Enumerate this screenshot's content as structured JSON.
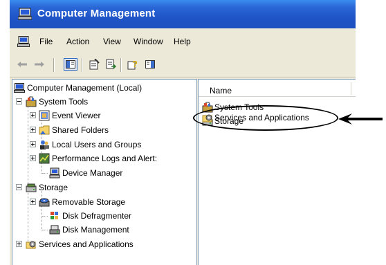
{
  "window": {
    "title": "Computer Management"
  },
  "menu": {
    "items": [
      "File",
      "Action",
      "View",
      "Window",
      "Help"
    ]
  },
  "toolbar": {
    "buttons": [
      "back-icon",
      "forward-icon",
      "show-hide-tree-icon",
      "properties-icon",
      "export-list-icon",
      "help-icon",
      "show-hide-action-pane-icon"
    ]
  },
  "tree": {
    "root": "Computer Management (Local)",
    "system_tools": "System Tools",
    "event_viewer": "Event Viewer",
    "shared_folders": "Shared Folders",
    "local_users": "Local Users and Groups",
    "perf_logs": "Performance Logs and Alert:",
    "device_manager": "Device Manager",
    "storage": "Storage",
    "removable_storage": "Removable Storage",
    "disk_defrag": "Disk Defragmenter",
    "disk_mgmt": "Disk Management",
    "services_apps": "Services and Applications"
  },
  "list": {
    "column": "Name",
    "items": [
      "System Tools",
      "Storage",
      "Services and Applications"
    ]
  },
  "colors": {
    "title_bar": "#1f55c8",
    "window_bg": "#ece9d8",
    "pane_border": "#7f9db9"
  }
}
